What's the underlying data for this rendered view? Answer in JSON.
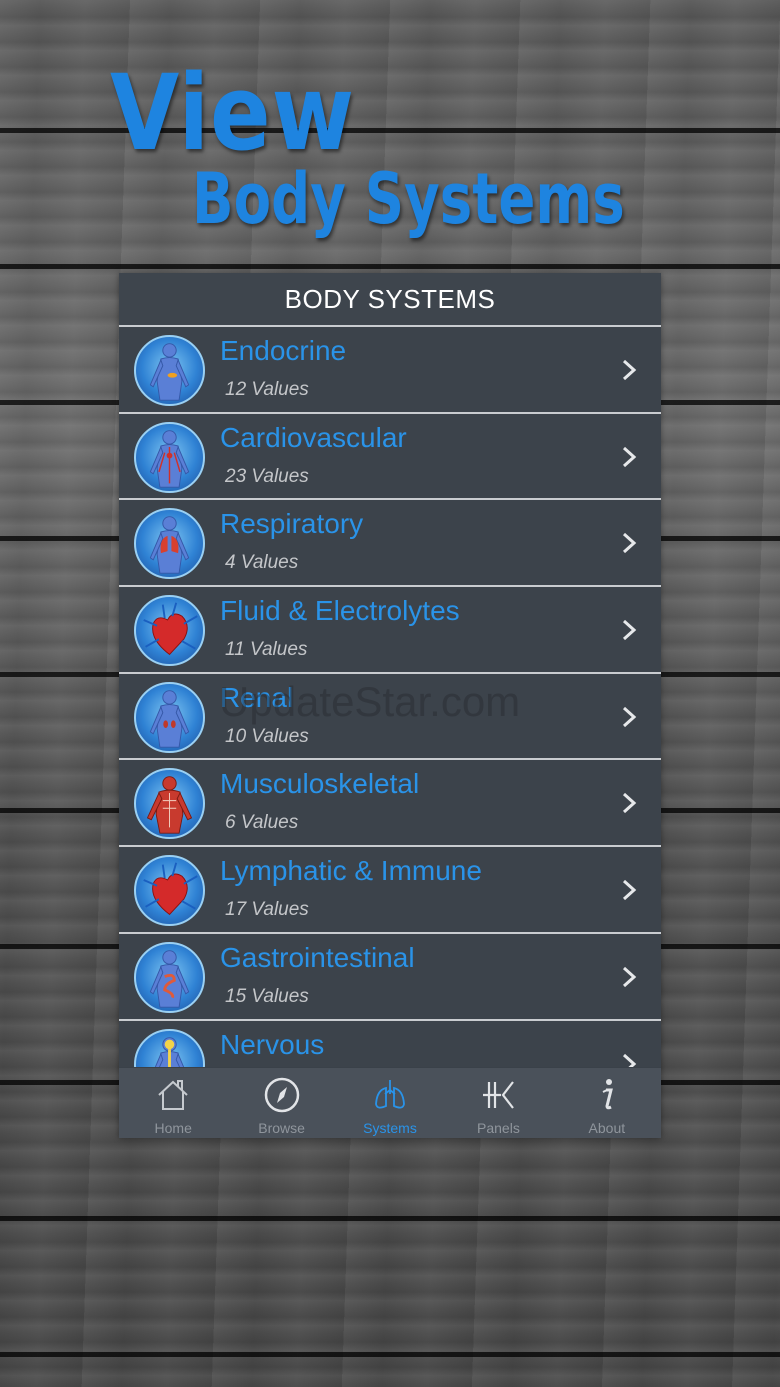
{
  "headline": {
    "line1": "View",
    "line2": "Body Systems"
  },
  "nav": {
    "title": "BODY SYSTEMS"
  },
  "systems": [
    {
      "name": "Endocrine",
      "count": "12 Values",
      "icon": "body-endocrine-icon"
    },
    {
      "name": "Cardiovascular",
      "count": "23 Values",
      "icon": "body-cardiovascular-icon"
    },
    {
      "name": "Respiratory",
      "count": "4 Values",
      "icon": "body-respiratory-icon"
    },
    {
      "name": "Fluid & Electrolytes",
      "count": "11 Values",
      "icon": "heart-icon"
    },
    {
      "name": "Renal",
      "count": "10 Values",
      "icon": "body-renal-icon"
    },
    {
      "name": "Musculoskeletal",
      "count": "6 Values",
      "icon": "muscle-body-icon"
    },
    {
      "name": "Lymphatic & Immune",
      "count": "17 Values",
      "icon": "heart-icon"
    },
    {
      "name": "Gastrointestinal",
      "count": "15 Values",
      "icon": "body-gastro-icon"
    },
    {
      "name": "Nervous",
      "count": "",
      "icon": "body-nervous-icon"
    }
  ],
  "watermark": "UpdateStar.com",
  "tabs": [
    {
      "label": "Home",
      "icon": "home-icon"
    },
    {
      "label": "Browse",
      "icon": "compass-icon"
    },
    {
      "label": "Systems",
      "icon": "lungs-icon",
      "active": true
    },
    {
      "label": "Panels",
      "icon": "panels-icon"
    },
    {
      "label": "About",
      "icon": "info-icon"
    }
  ],
  "colors": {
    "accent": "#2a93e8",
    "headline": "#1e84e0",
    "panel_bg": "#3c434b",
    "tabbar_bg": "#4a515a"
  }
}
